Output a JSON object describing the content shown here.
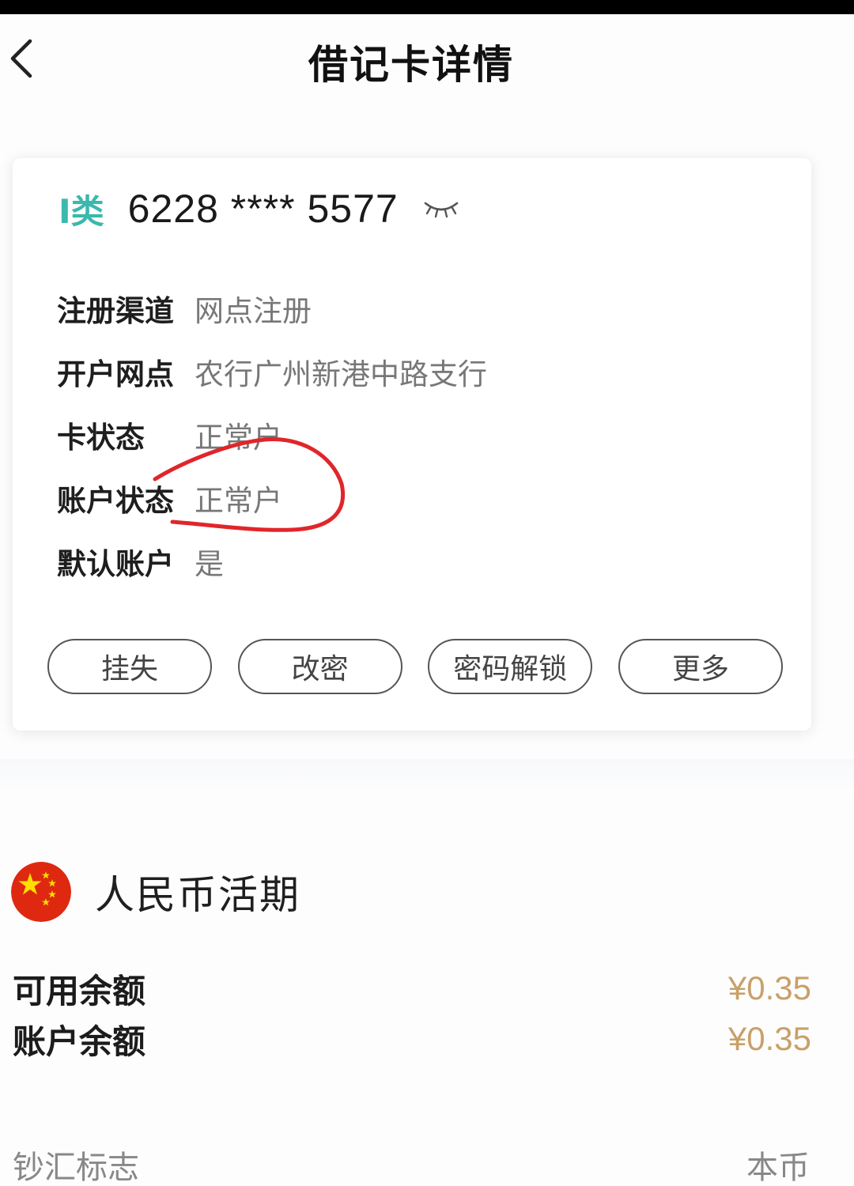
{
  "header": {
    "title": "借记卡详情",
    "back_icon": "chevron-left-icon"
  },
  "card": {
    "class_label": "I类",
    "number": "6228 **** 5577",
    "visibility_icon": "eye-closed-icon",
    "details": [
      {
        "label": "注册渠道",
        "value": "网点注册"
      },
      {
        "label": "开户网点",
        "value": "农行广州新港中路支行"
      },
      {
        "label": "卡状态",
        "value": "正常户"
      },
      {
        "label": "账户状态",
        "value": "正常户"
      },
      {
        "label": "默认账户",
        "value": "是"
      }
    ],
    "actions": [
      "挂失",
      "改密",
      "密码解锁",
      "更多"
    ]
  },
  "account": {
    "flag_icon": "china-flag-icon",
    "currency_title": "人民币活期",
    "available_label": "可用余额",
    "available_value": "¥0.35",
    "balance_label": "账户余额",
    "balance_value": "¥0.35",
    "cash_remit_label": "钞汇标志",
    "cash_remit_value": "本币"
  },
  "colors": {
    "accent_teal": "#3cb8ad",
    "amount_gold": "#c9a06a",
    "annotation_red": "#e0262a"
  }
}
